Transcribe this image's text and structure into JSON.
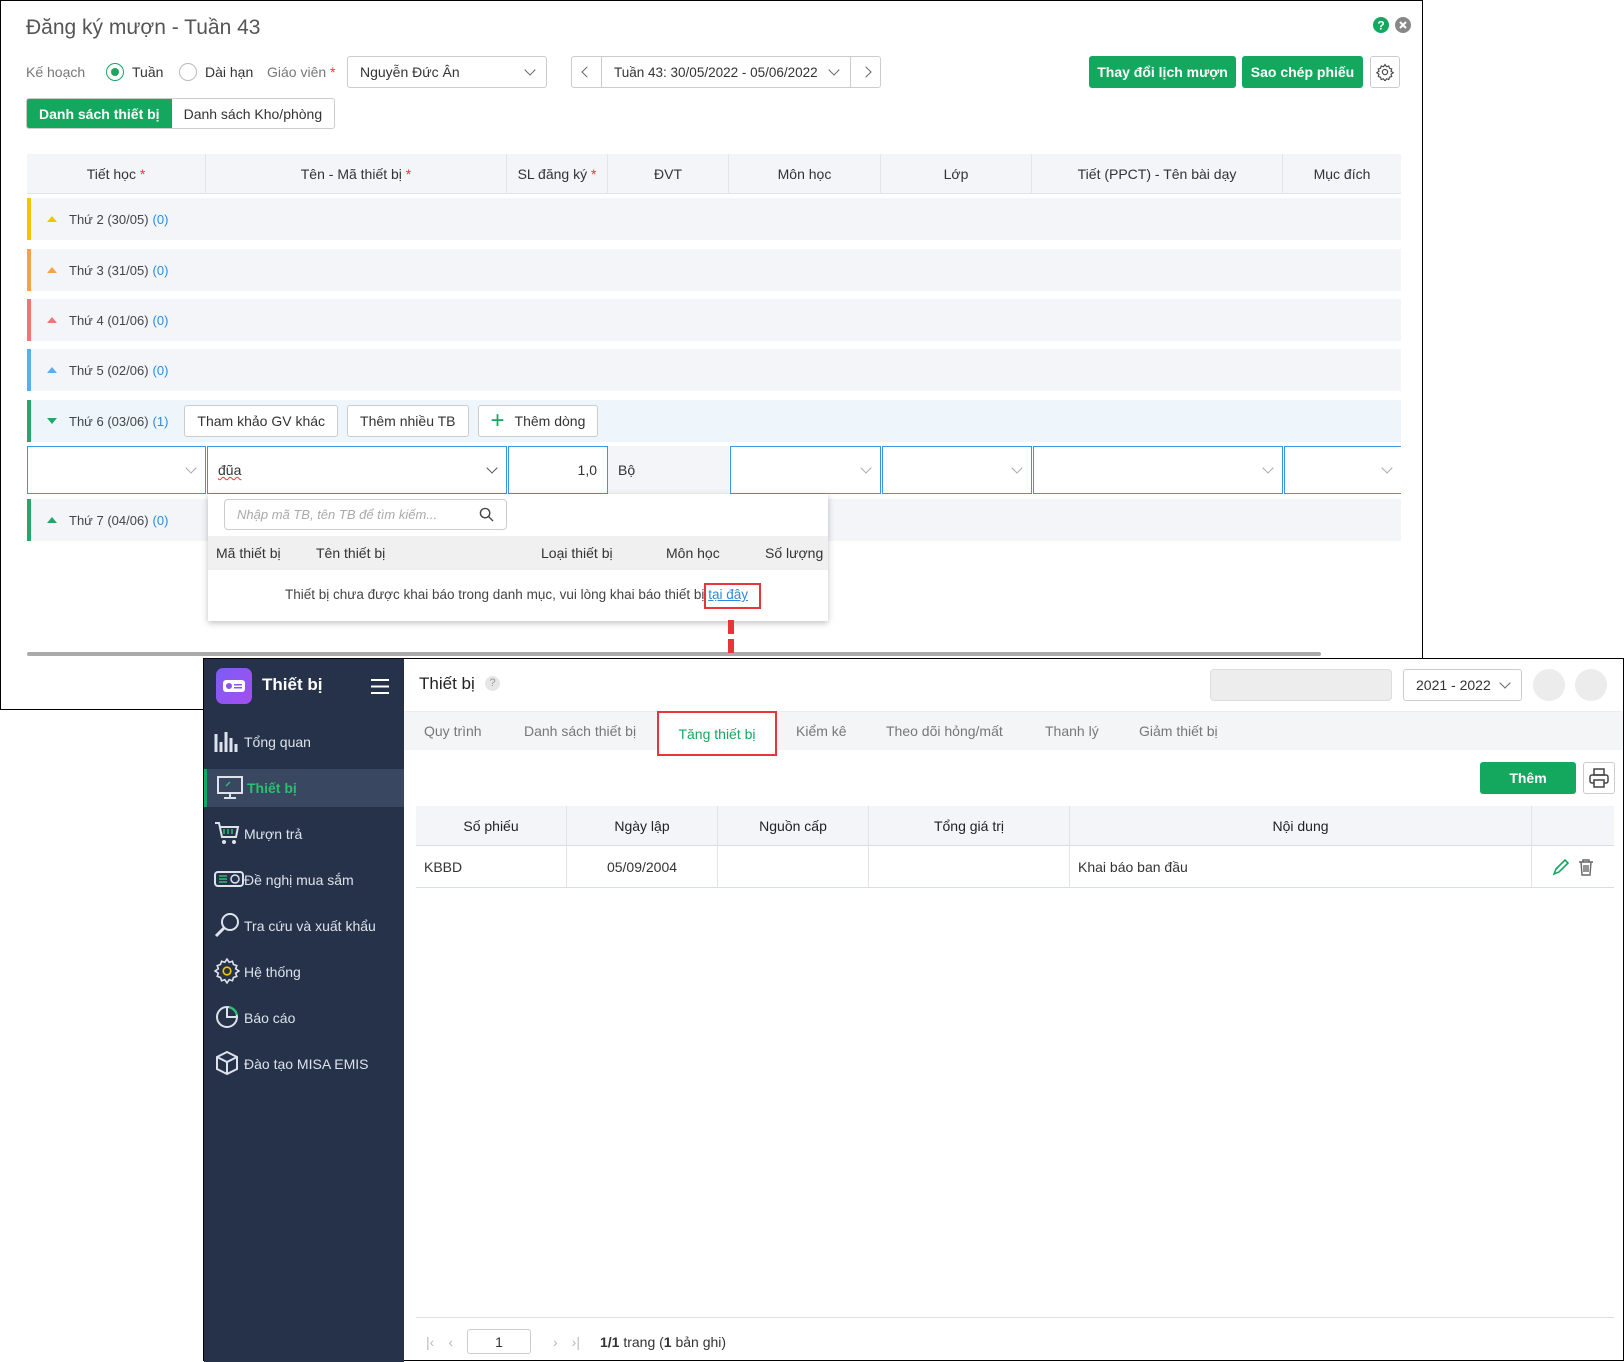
{
  "borrow": {
    "title": "Đăng ký mượn - Tuần 43",
    "plan_label": "Kế hoạch",
    "radio_week": "Tuần",
    "radio_long": "Dài hạn",
    "teacher_label": "Giáo viên",
    "required": "*",
    "teacher_value": "Nguyễn Đức Ân",
    "week_value": "Tuần 43: 30/05/2022 - 05/06/2022",
    "btn_change": "Thay đổi lịch mượn",
    "btn_copy": "Sao chép phiếu",
    "tabs": [
      "Danh sách thiết bị",
      "Danh sách Kho/phòng"
    ],
    "columns": [
      "Tiết học",
      "Tên - Mã thiết bị",
      "SL đăng ký",
      "ĐVT",
      "Môn học",
      "Lớp",
      "Tiết (PPCT) - Tên bài dạy",
      "Mục đích"
    ],
    "days": [
      {
        "label": "Thứ 2 (30/05)",
        "count": "(0)",
        "color": "#f5c400"
      },
      {
        "label": "Thứ 3 (31/05)",
        "count": "(0)",
        "color": "#f7a24a"
      },
      {
        "label": "Thứ 4 (01/06)",
        "count": "(0)",
        "color": "#f27575"
      },
      {
        "label": "Thứ 5 (02/06)",
        "count": "(0)",
        "color": "#5aaef0"
      },
      {
        "label": "Thứ 6 (03/06)",
        "count": "(1)",
        "color": "#28a66a"
      },
      {
        "label": "Thứ 7 (04/06)",
        "count": "(0)",
        "color": "#28a66a"
      }
    ],
    "day_buttons": [
      "Tham khảo GV khác",
      "Thêm nhiều TB",
      "Thêm dòng"
    ],
    "row": {
      "device": "đũa",
      "qty": "1,0",
      "unit": "Bộ"
    },
    "dropdown": {
      "search_placeholder": "Nhập mã TB, tên TB để tìm kiếm...",
      "columns": [
        "Mã thiết bị",
        "Tên thiết bị",
        "Loại thiết bị",
        "Môn học",
        "Số lượng"
      ],
      "message": "Thiết bị chưa được khai báo trong danh mục, vui lòng khai báo thiết bị",
      "link": "tại đây"
    }
  },
  "equip": {
    "app_name": "Thiết bị",
    "page_title": "Thiết bị",
    "help": "?",
    "year": "2021 - 2022",
    "nav": [
      "Tổng quan",
      "Thiết bị",
      "Mượn trả",
      "Đề nghị mua sắm",
      "Tra cứu và xuất khẩu",
      "Hệ thống",
      "Báo cáo",
      "Đào tạo MISA EMIS"
    ],
    "tabs": [
      "Quy trình",
      "Danh sách thiết bị",
      "Tăng thiết bị",
      "Kiểm kê",
      "Theo dõi hỏng/mất",
      "Thanh lý",
      "Giảm thiết bị"
    ],
    "add_btn": "Thêm",
    "columns": [
      "Số phiếu",
      "Ngày lập",
      "Nguồn cấp",
      "Tổng giá trị",
      "Nội dung"
    ],
    "rows": [
      {
        "so_phieu": "KBBD",
        "ngay_lap": "05/09/2004",
        "nguon_cap": "",
        "tong_gia_tri": "",
        "noi_dung": "Khai báo ban đầu"
      }
    ],
    "pagination": {
      "page": "1",
      "pages": "1/1",
      "pages_word": "trang (",
      "records": "1",
      "records_word": "bản ghi)"
    }
  },
  "colors": {
    "accent": "#14a85f",
    "link": "#2b8be0",
    "highlight": "#e8343a",
    "sidebar": "#25324a"
  }
}
